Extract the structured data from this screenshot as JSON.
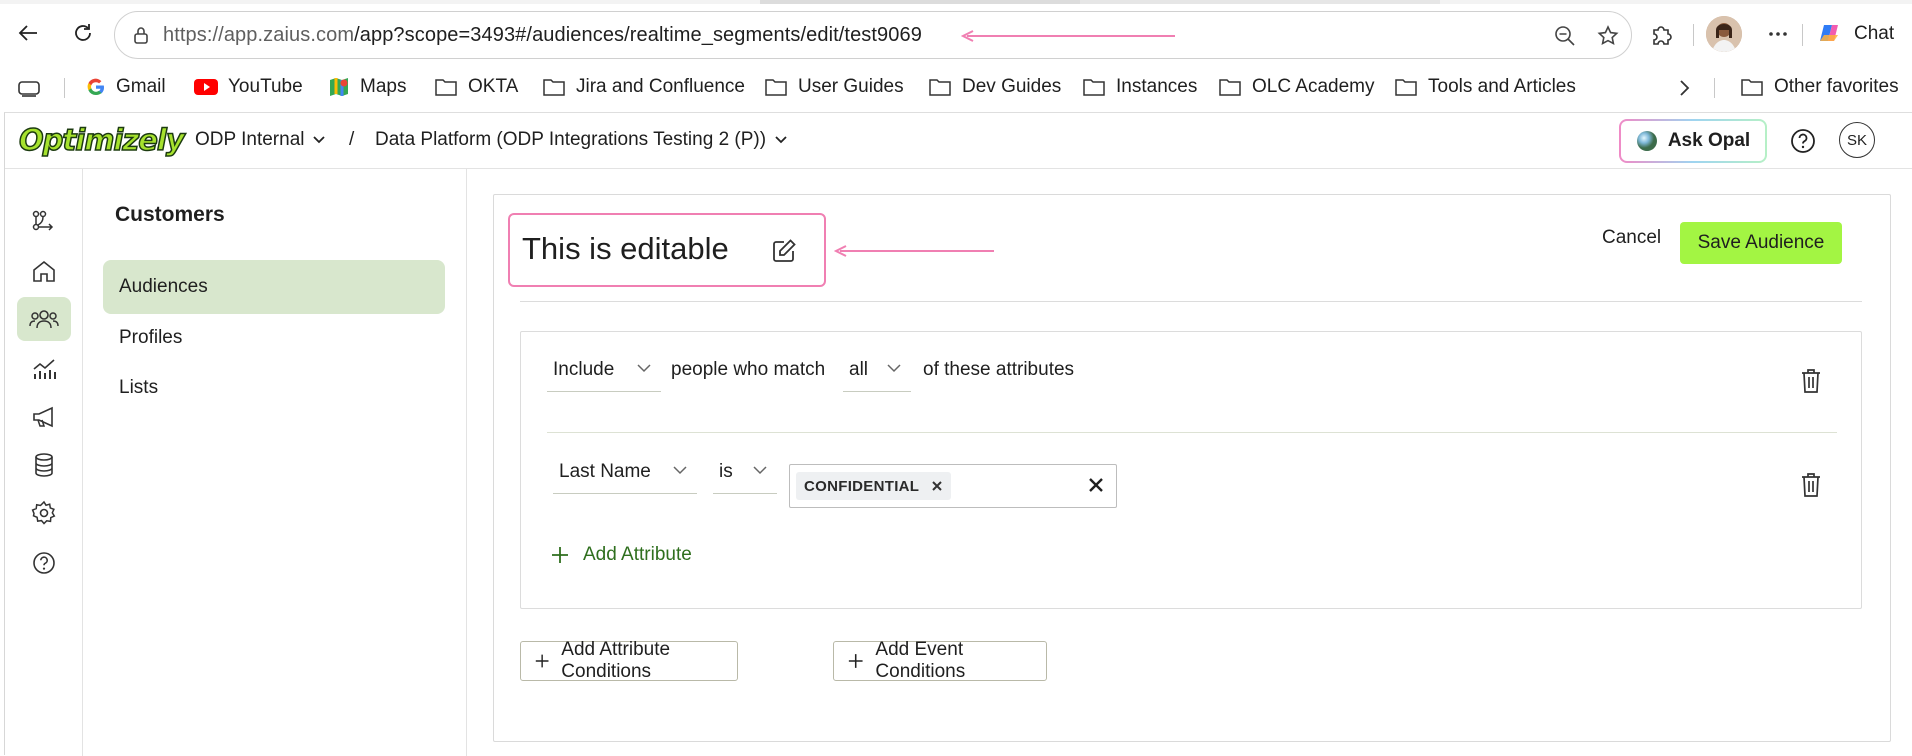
{
  "browser": {
    "url_host": "https://app.zaius.com",
    "url_path": "/app?scope=3493#/audiences/realtime_segments/edit/test9069",
    "chat_label": "Chat",
    "annotation_color": "#f07fb2"
  },
  "bookmarks": {
    "items": [
      "Gmail",
      "YouTube",
      "Maps",
      "OKTA",
      "Jira and Confluence",
      "User Guides",
      "Dev Guides",
      "Instances",
      "OLC Academy",
      "Tools and Articles"
    ],
    "other": "Other favorites"
  },
  "app": {
    "logo": "Optimizely",
    "org": "ODP Internal",
    "breadcrumb_sep": "/",
    "project": "Data Platform (ODP Integrations Testing 2 (P))",
    "ask_opal": "Ask Opal",
    "avatar_initials": "SK",
    "accent_color": "#a3f543"
  },
  "rail": {
    "icons": [
      "flow-icon",
      "home-icon",
      "customers-icon",
      "analytics-icon",
      "campaign-icon",
      "database-icon",
      "settings-icon",
      "help-icon"
    ],
    "active": "customers-icon"
  },
  "subnav": {
    "title": "Customers",
    "items": [
      "Audiences",
      "Profiles",
      "Lists"
    ],
    "active": "Audiences"
  },
  "editor": {
    "title": "This is editable",
    "cancel": "Cancel",
    "save": "Save Audience",
    "match": {
      "mode": "Include",
      "text_before": "people who match",
      "quantifier": "all",
      "text_after": "of these attributes"
    },
    "condition": {
      "attribute": "Last Name",
      "operator": "is",
      "value_chip": "CONFIDENTIAL"
    },
    "add_attribute": "Add Attribute",
    "add_attribute_conditions": "Add Attribute Conditions",
    "add_event_conditions": "Add Event Conditions"
  }
}
